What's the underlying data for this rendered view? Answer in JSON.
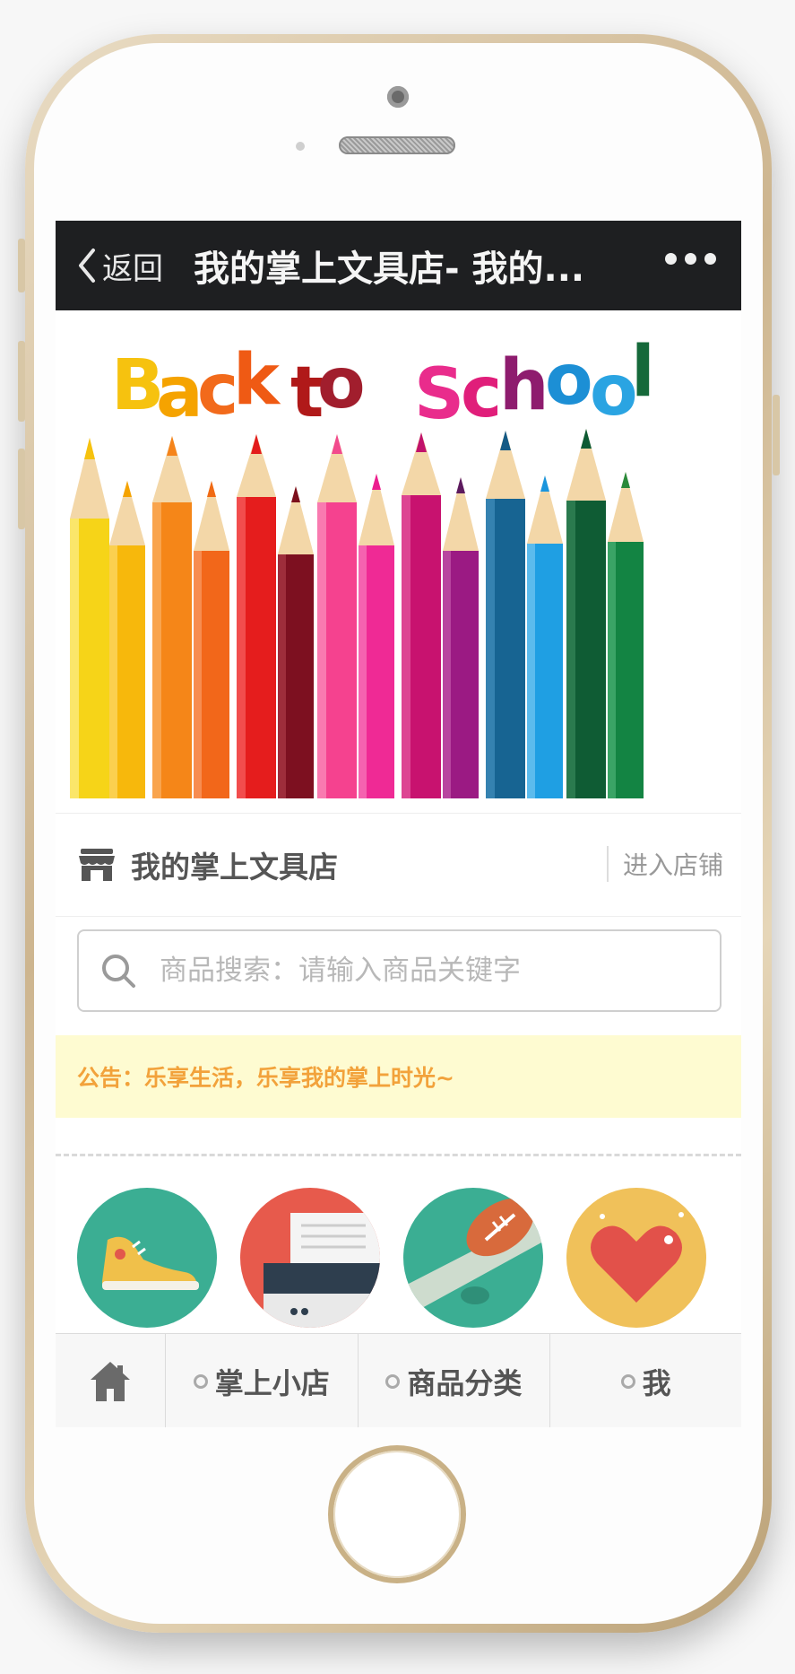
{
  "navbar": {
    "back_label": "返回",
    "title": "我的掌上文具店- 我的...",
    "more_icon": "more-dots-icon"
  },
  "banner": {
    "headline_letters": [
      "B",
      "a",
      "c",
      "k",
      " ",
      "t",
      "o",
      " ",
      "S",
      "c",
      "h",
      "o",
      "o",
      "l"
    ],
    "letter_colors": [
      "#f6c20f",
      "#f5a300",
      "#f26a1b",
      "#ef5a14",
      "#ffffff",
      "#b01919",
      "#a11e2d",
      "#ffffff",
      "#e92c8c",
      "#e01e7a",
      "#8e1c6e",
      "#1c8fd5",
      "#2aa4e2",
      "#15693a"
    ],
    "slide_count": 2,
    "active_slide": 2
  },
  "shop": {
    "icon": "storefront-icon",
    "name": "我的掌上文具店",
    "enter_label": "进入店铺"
  },
  "search": {
    "icon": "search-icon",
    "placeholder": "商品搜索：请输入商品关键字"
  },
  "notice": {
    "text": "公告：乐享生活，乐享我的掌上时光~"
  },
  "categories": [
    {
      "icon": "sneaker-icon",
      "bg": "#3bae93"
    },
    {
      "icon": "printer-icon",
      "bg": "#e75a4c"
    },
    {
      "icon": "football-icon",
      "bg": "#3bae93"
    },
    {
      "icon": "heart-icon",
      "bg": "#f0c15a"
    }
  ],
  "tabbar": {
    "home_icon": "home-icon",
    "tabs": [
      {
        "label": "掌上小店"
      },
      {
        "label": "商品分类"
      },
      {
        "label": "我"
      }
    ]
  },
  "colors": {
    "navbar_bg": "#1e1f21",
    "notice_bg": "#fefbd1",
    "notice_text": "#f2a23b",
    "frame_gold": "#cdb58f"
  }
}
